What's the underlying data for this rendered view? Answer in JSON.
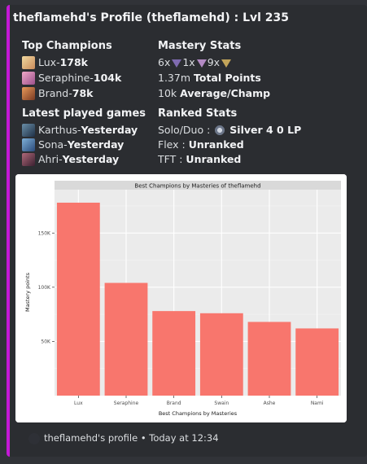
{
  "profile": {
    "title": "theflamehd's Profile (theflamehd) : Lvl 235"
  },
  "top_champions": {
    "heading": "Top Champions",
    "items": [
      {
        "name": "Lux",
        "sep": " - ",
        "value": "178k"
      },
      {
        "name": "Seraphine",
        "sep": " - ",
        "value": "104k"
      },
      {
        "name": "Brand",
        "sep": " - ",
        "value": "78k"
      }
    ]
  },
  "mastery_stats": {
    "heading": "Mastery Stats",
    "tokens": [
      {
        "count": "6x"
      },
      {
        "count": "1x"
      },
      {
        "count": "9x"
      }
    ],
    "total_value": "1.37m",
    "total_label": "Total Points",
    "average_value": "10k",
    "average_label": "Average/Champ"
  },
  "latest_games": {
    "heading": "Latest played games",
    "items": [
      {
        "name": "Karthus",
        "sep": " - ",
        "when": "Yesterday"
      },
      {
        "name": "Sona",
        "sep": " - ",
        "when": "Yesterday"
      },
      {
        "name": "Ahri",
        "sep": " - ",
        "when": "Yesterday"
      }
    ]
  },
  "ranked_stats": {
    "heading": "Ranked Stats",
    "solo_label": "Solo/Duo :",
    "solo_value": "Silver 4 0 LP",
    "flex_label": "Flex :",
    "flex_value": "Unranked",
    "tft_label": "TFT :",
    "tft_value": "Unranked"
  },
  "chart_data": {
    "type": "bar",
    "title": "Best Champions by Masteries of theflamehd",
    "xlabel": "Best Champions by Masteries",
    "ylabel": "Mastery points",
    "categories": [
      "Lux",
      "Seraphine",
      "Brand",
      "Swain",
      "Ashe",
      "Nami"
    ],
    "values": [
      178000,
      104000,
      78000,
      76000,
      68000,
      62000
    ],
    "ylim": [
      0,
      190000
    ],
    "yticks": [
      50000,
      100000,
      150000
    ],
    "ytick_labels": [
      "50K",
      "100K",
      "150K"
    ],
    "bar_color": "#f8766d",
    "panel_color": "#ebebeb",
    "grid": true
  },
  "footer": {
    "text": "theflamehd's profile • Today at 12:34"
  },
  "colors": {
    "accent_bar": "#c419d6",
    "embed_bg": "#2b2d31",
    "page_bg": "#313338"
  }
}
